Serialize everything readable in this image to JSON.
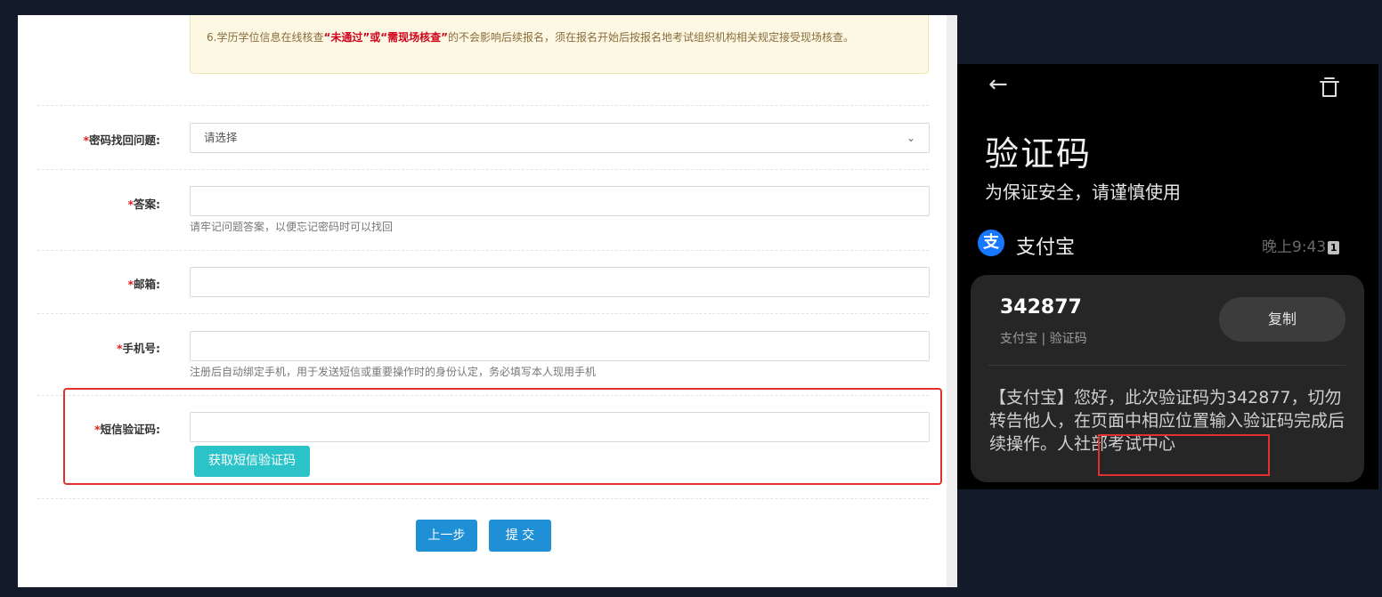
{
  "form": {
    "notice_text": "6.学历学位信息在线核查",
    "notice_highlight": "“未通过”或“需现场核查”",
    "notice_rest": "的不会影响后续报名，须在报名开始后按报名地考试组织机构相关规定接受现场核查。",
    "required_mark": "*",
    "question_label": "密码找回问题:",
    "question_value": "请选择",
    "answer_label": "答案:",
    "answer_help": "请牢记问题答案，以便忘记密码时可以找回",
    "email_label": "邮箱:",
    "phone_label": "手机号:",
    "phone_help": "注册后自动绑定手机，用于发送短信或重要操作时的身份认定，务必填写本人现用手机",
    "sms_label": "短信验证码:",
    "get_sms_button": "获取短信验证码",
    "prev_button": "上一步",
    "submit_button": "提 交"
  },
  "phone": {
    "title": "验证码",
    "subtitle": "为保证安全，请谨慎使用",
    "alipay_icon_char": "支",
    "sender": "支付宝",
    "time": "晚上9:43",
    "sim_slot": "1",
    "code": "342877",
    "code_caption": "支付宝 | 验证码",
    "copy_button": "复制",
    "message": "【支付宝】您好，此次验证码为342877，切勿转告他人，在页面中相应位置输入验证码完成后续操作。人社部考试中心"
  },
  "icons": {
    "back": "arrow-left-icon",
    "delete": "trash-icon",
    "dropdown": "chevron-down-icon",
    "alipay": "alipay-logo-icon"
  },
  "colors": {
    "required": "#e02020",
    "notice_bg": "#fcf8e3",
    "highlight_red": "#d0021b",
    "teal_button": "#2cc3c8",
    "blue_button": "#1f8fd6",
    "alipay_blue": "#1677ff"
  }
}
